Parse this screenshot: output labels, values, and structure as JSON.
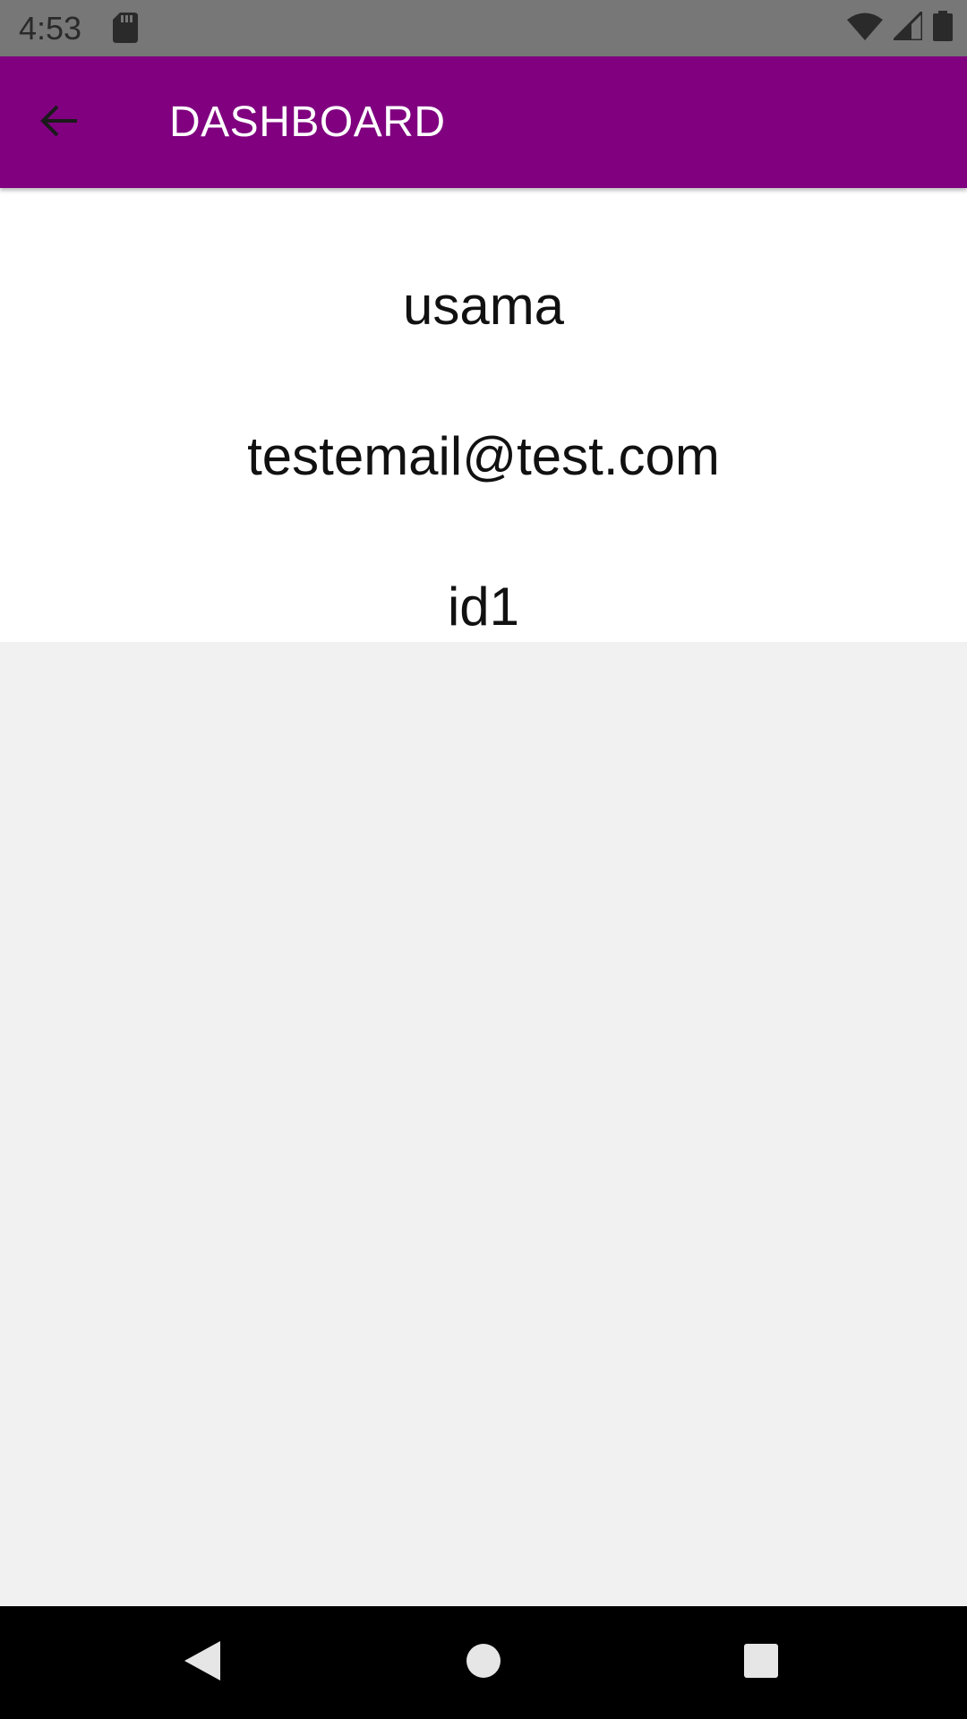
{
  "status_bar": {
    "time": "4:53",
    "icons": [
      "sd-card-icon",
      "wifi-icon",
      "signal-icon",
      "battery-icon"
    ]
  },
  "app_bar": {
    "title": "DASHBOARD",
    "back_icon": "arrow-back-icon",
    "color": "#800080"
  },
  "profile": {
    "name": "usama",
    "email": "testemail@test.com",
    "id": "id1"
  },
  "nav_bar": {
    "buttons": [
      "back-triangle-icon",
      "home-circle-icon",
      "recents-square-icon"
    ]
  }
}
